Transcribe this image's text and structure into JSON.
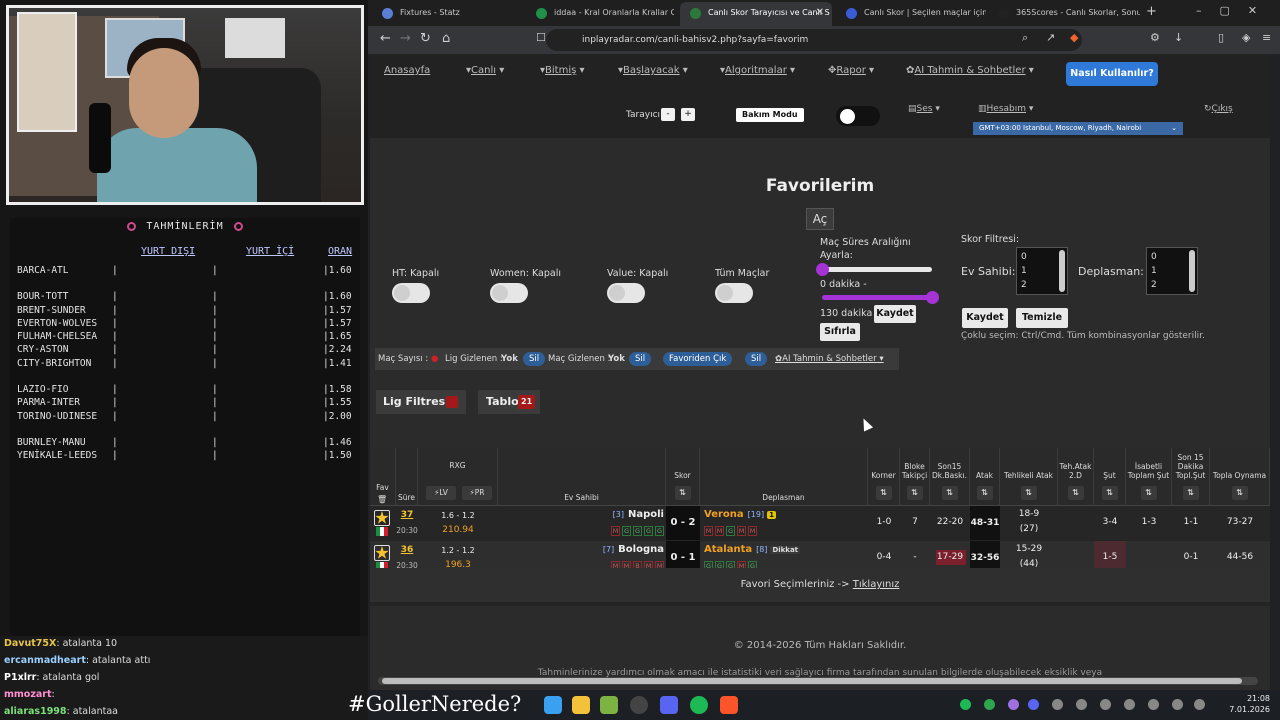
{
  "overlay": {
    "title": "TAHMİNLERİM",
    "col_away": "YURT DIŞI",
    "col_home": "YURT İÇİ",
    "col_odds": "ORAN",
    "groups": [
      [
        {
          "match": "BARCA-ATL",
          "odd": "1.60"
        }
      ],
      [
        {
          "match": "BOUR-TOTT",
          "odd": "1.60"
        },
        {
          "match": "BRENT-SUNDER",
          "odd": "1.57"
        },
        {
          "match": "EVERTON-WOLVES",
          "odd": "1.57"
        },
        {
          "match": "FULHAM-CHELSEA",
          "odd": "1.65"
        },
        {
          "match": "CRY-ASTON",
          "odd": "2.24"
        },
        {
          "match": "CITY-BRIGHTON",
          "odd": "1.41"
        }
      ],
      [
        {
          "match": "LAZIO-FIO",
          "odd": "1.58"
        },
        {
          "match": "PARMA-INTER",
          "odd": "1.55"
        },
        {
          "match": "TORINO-UDINESE",
          "odd": "2.00"
        }
      ],
      [
        {
          "match": "BURNLEY-MANU",
          "odd": "1.46"
        },
        {
          "match": "YENİKALE-LEEDS",
          "odd": "1.50"
        }
      ]
    ],
    "chat": [
      {
        "user": "Davut75X",
        "msg": ": atalanta 10",
        "color": "#e8c54a"
      },
      {
        "user": "ercanmadheart",
        "msg": ": atalanta attı",
        "color": "#9ad0ff"
      },
      {
        "user": "P1xlrr",
        "msg": ": atalanta gol",
        "color": "#ffffff"
      },
      {
        "user": "mmozart",
        "msg": ":",
        "color": "#ff8fd0"
      },
      {
        "user": "aliaras1998",
        "msg": ": atalantaa",
        "color": "#7de07d"
      }
    ],
    "hashtag": "#GollerNerede?"
  },
  "browser": {
    "tabs": [
      {
        "label": "Fixtures - Statz",
        "color": "#5b7fd6"
      },
      {
        "label": "iddaa - Kral Oranlarla Krallar Gibi",
        "color": "#1f8f4a"
      },
      {
        "label": "Canlı Skor Tarayıcısı ve Canlı S",
        "color": "#2c7a3b",
        "close": "✕"
      },
      {
        "label": "Canlı Skor | Seçilen maçlar için ca",
        "color": "#3b5bd6"
      },
      {
        "label": "365Scores - Canlı Skorlar, Sonuçla",
        "color": "#222"
      }
    ],
    "url": "inplayradar.com/canli-bahisv2.php?sayfa=favorim"
  },
  "nav": {
    "items": [
      "Anasayfa",
      "Canlı",
      "Bitmiş",
      "Başlayacak",
      "Algoritmalar",
      "Rapor",
      "AI Tahmin & Sohbetler"
    ],
    "how_button": "Nasıl Kullanılır?",
    "tarayici": "Tarayıcı",
    "minus": "-",
    "plus": "+",
    "bakim": "Bakım Modu",
    "ses": "Ses",
    "hesabim": "Hesabım",
    "cikis": "Çıkış",
    "timezone": "GMT+03:00 Istanbul, Moscow, Riyadh, Nairobi"
  },
  "main": {
    "title": "Favorilerim",
    "ac": "Aç",
    "toggles": [
      "HT: Kapalı",
      "Women: Kapalı",
      "Value: Kapalı",
      "Tüm Maçlar"
    ],
    "mac_sure": "Maç Süres Aralığını Ayarla:",
    "min_label": "0 dakika -",
    "max_label": "130 dakika",
    "slider_min": 0,
    "slider_max": 130,
    "kaydet": "Kaydet",
    "sifirla": "Sıfırla",
    "skor_filtresi": "Skor Filtresi:",
    "ev_sahibi": "Ev Sahibi:",
    "deplasman": "Deplasman:",
    "score_options": [
      "0",
      "1",
      "2"
    ],
    "kaydet2": "Kaydet",
    "temizle": "Temizle",
    "coklu": "Çoklu seçim: Ctrl/Cmd. Tüm kombinasyonlar gösterilir.",
    "filterbar": {
      "mac_sayisi": "Maç Sayısı :",
      "lig_gizlenen": "Lig Gizlenen :",
      "yok1": "Yok",
      "sil": "Sil",
      "mac_gizlenen": "Maç Gizlenen :",
      "yok2": "Yok",
      "favoriden": "Favoriden Çık",
      "ai": "AI Tahmin & Sohbetler"
    },
    "lig_filtresi": "Lig Filtresi",
    "tablo": "Tablo",
    "tablo_count": "21",
    "fav_sel": "Favori Seçimleriniz ->",
    "fav_link": "Tıklayınız",
    "copyright": "© 2014-2026 Tüm Hakları Saklıdır.",
    "disclaimer": "Tahminlerinize yardımcı olmak amacı ile istatistiki veri sağlayıcı firma tarafından sunulan bilgilerde oluşabilecek eksiklik veya"
  },
  "table": {
    "headers": {
      "fav": "Fav",
      "sure": "Süre",
      "rxg": "RXG",
      "lv": "LV",
      "pr": "PR",
      "ev": "Ev Sahibi",
      "skor": "Skor",
      "dep": "Deplasman",
      "korner": "Korner",
      "bloke": "Bloke Takipçi",
      "son15": "Son15 Dk.Baskı.",
      "atak": "Atak",
      "tehlikeli": "Tehlikeli Atak",
      "tehatak": "Teh.Atak 2.D",
      "sut": "Şut",
      "isabetli": "İsabetli Toplam Şut",
      "son15sut": "Son 15 Dakika Topl.Şut",
      "topla": "Topla Oynama"
    },
    "rows": [
      {
        "minute": "37",
        "time": "20:30",
        "rxg": "1.6 - 1.2",
        "pr": "210.94",
        "home_rank": "[3]",
        "home": "Napoli",
        "home_form": [
          "M",
          "G",
          "G",
          "G",
          "G"
        ],
        "score": "0 - 2",
        "away": "Verona",
        "away_rank": "[19]",
        "away_badge": "1",
        "away_form": [
          "M",
          "M",
          "G",
          "M",
          "M"
        ],
        "korner": "1-0",
        "bloke": "7",
        "son15": "22-20",
        "atak": "48-31",
        "tehlikeli": "18-9",
        "tehlikeli2": "(27)",
        "tehatak": "",
        "sut": "3-4",
        "isabetli": "1-3",
        "son15sut": "1-1",
        "topla": "73-27"
      },
      {
        "minute": "36",
        "time": "20:30",
        "rxg": "1.2 - 1.2",
        "pr": "196.3",
        "home_rank": "[7]",
        "home": "Bologna",
        "home_form": [
          "M",
          "M",
          "B",
          "M",
          "M"
        ],
        "score": "0 - 1",
        "away": "Atalanta",
        "away_rank": "[8]",
        "away_badge": "Dikkat",
        "away_form": [
          "G",
          "G",
          "G",
          "M",
          "G"
        ],
        "korner": "0-4",
        "bloke": "-",
        "son15": "17-29",
        "atak": "32-56",
        "tehlikeli": "15-29",
        "tehlikeli2": "(44)",
        "tehatak": "",
        "sut": "1-5",
        "isabetli": "",
        "son15sut": "0-1",
        "topla": "44-56"
      }
    ]
  },
  "taskbar": {
    "time": "21:08",
    "date": "7.01.2026"
  }
}
